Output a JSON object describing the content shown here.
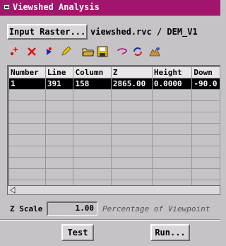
{
  "window": {
    "title": "Viewshed Analysis"
  },
  "raster": {
    "button_label": "Input Raster...",
    "path": "viewshed.rvc / DEM_V1"
  },
  "toolbar": {
    "icons": [
      "add-point-icon",
      "delete-icon",
      "select-arrow-icon",
      "edit-pencil-icon",
      "open-folder-icon",
      "save-disk-icon",
      "lasso-icon",
      "refresh-icon",
      "viewshed-icon"
    ]
  },
  "table": {
    "headers": [
      "Number",
      "Line",
      "Column",
      "Z",
      "Height",
      "Down"
    ],
    "rows": [
      [
        "1",
        "391",
        "158",
        "2865.00",
        "0.0000",
        "-90.0"
      ]
    ]
  },
  "zscale": {
    "label": "Z Scale",
    "value": "1.00",
    "description": "Percentage of Viewpoint"
  },
  "buttons": {
    "test": "Test",
    "run": "Run..."
  },
  "colors": {
    "titlebar": "#a1166c",
    "panel": "#c6c3c6",
    "selected_row": "#000000"
  }
}
